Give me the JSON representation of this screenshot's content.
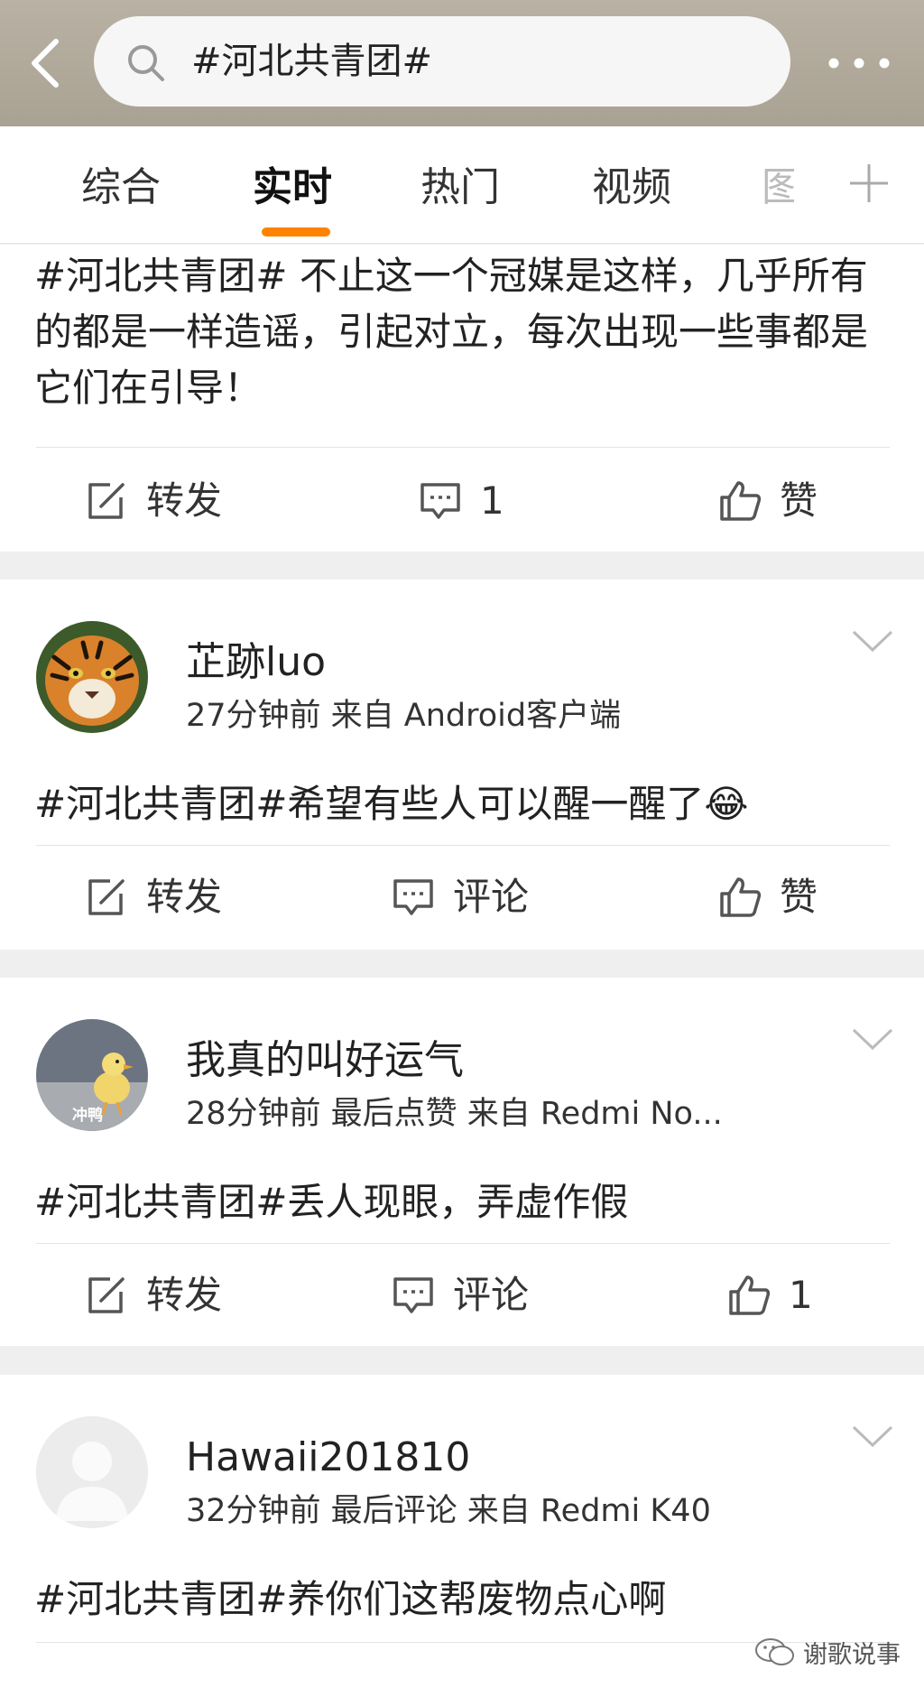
{
  "header": {
    "search_query": "#河北共青团#"
  },
  "tabs": [
    {
      "label": "综合"
    },
    {
      "label": "实时"
    },
    {
      "label": "热门"
    },
    {
      "label": "视频"
    },
    {
      "label": "图"
    }
  ],
  "active_tab": "实时",
  "accent_color": "#ff8200",
  "posts": [
    {
      "text": "#河北共青团# 不止这一个冠媒是这样，几乎所有的都是一样造谣，引起对立，每次出现一些事都是它们在引导！",
      "actions": {
        "repost": "转发",
        "comment": "1",
        "like": "赞"
      }
    },
    {
      "username": "芷跡luo",
      "meta": "27分钟前  来自 Android客户端",
      "text": "#河北共青团#希望有些人可以醒一醒了😂",
      "actions": {
        "repost": "转发",
        "comment": "评论",
        "like": "赞"
      }
    },
    {
      "username": "我真的叫好运气",
      "meta": "28分钟前 最后点赞  来自 Redmi No...",
      "avatar_caption": "冲鸭",
      "text": "#河北共青团#丢人现眼，弄虚作假",
      "actions": {
        "repost": "转发",
        "comment": "评论",
        "like": "1"
      }
    },
    {
      "username": "Hawaii201810",
      "meta": "32分钟前 最后评论  来自 Redmi K40",
      "text": "#河北共青团#养你们这帮废物点心啊"
    }
  ],
  "watermark": "谢歌说事",
  "icons": [
    "back-arrow-icon",
    "search-icon",
    "more-icon",
    "plus-icon",
    "repost-icon",
    "comment-icon",
    "like-icon",
    "chevron-down-icon",
    "wechat-icon"
  ]
}
